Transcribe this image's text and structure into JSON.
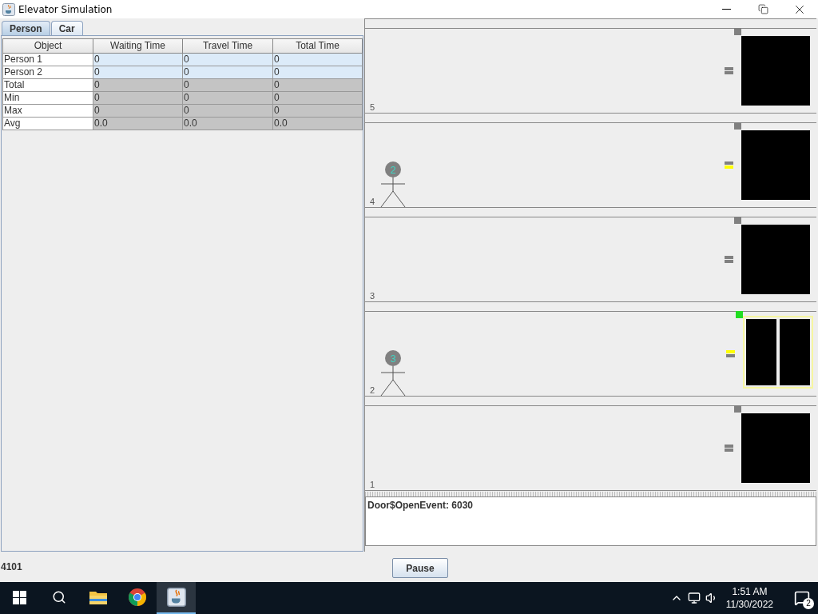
{
  "window": {
    "title": "Elevator Simulation"
  },
  "tabs": [
    {
      "label": "Person",
      "selected": true
    },
    {
      "label": "Car",
      "selected": false
    }
  ],
  "table": {
    "columns": [
      "Object",
      "Waiting Time",
      "Travel Time",
      "Total Time"
    ],
    "rows": [
      {
        "kind": "person",
        "cells": [
          "Person 1",
          "0",
          "0",
          "0"
        ]
      },
      {
        "kind": "person",
        "cells": [
          "Person 2",
          "0",
          "0",
          "0"
        ]
      },
      {
        "kind": "stat",
        "cells": [
          "Total",
          "0",
          "0",
          "0"
        ]
      },
      {
        "kind": "stat",
        "cells": [
          "Min",
          "0",
          "0",
          "0"
        ]
      },
      {
        "kind": "stat",
        "cells": [
          "Max",
          "0",
          "0",
          "0"
        ]
      },
      {
        "kind": "stat",
        "cells": [
          "Avg",
          "0.0",
          "0.0",
          "0.0"
        ]
      }
    ]
  },
  "floors": [
    {
      "number": "5",
      "up_call": false,
      "down_call": false,
      "car_here": false,
      "doors_open": false
    },
    {
      "number": "4",
      "person": "2",
      "up_call": false,
      "down_call": true,
      "car_here": false,
      "doors_open": false
    },
    {
      "number": "3",
      "up_call": false,
      "down_call": false,
      "car_here": false,
      "doors_open": false
    },
    {
      "number": "2",
      "person": "3",
      "up_call": true,
      "down_call": false,
      "car_here": true,
      "doors_open": true
    },
    {
      "number": "1",
      "up_call": false,
      "down_call": false,
      "car_here": false,
      "doors_open": false
    }
  ],
  "log": "Door$OpenEvent: 6030",
  "status": "4101",
  "pause_button": "Pause",
  "taskbar": {
    "apps": [
      {
        "kind": "explorer",
        "selected": false
      },
      {
        "kind": "chrome",
        "selected": false
      },
      {
        "kind": "java",
        "selected": true
      }
    ],
    "time": "1:51 AM",
    "date": "11/30/2022",
    "notifications": "2"
  }
}
